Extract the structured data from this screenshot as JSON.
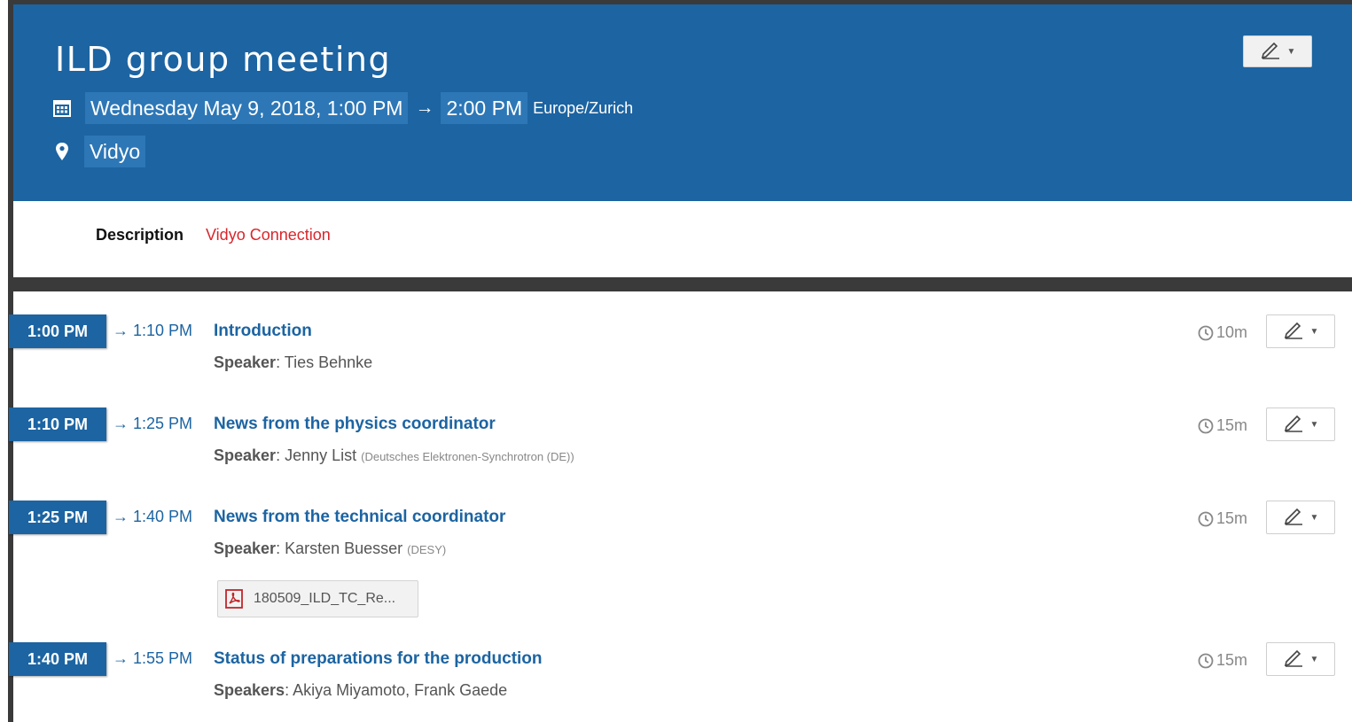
{
  "event": {
    "title": "ILD group meeting",
    "start_datetime": "Wednesday May 9, 2018, 1:00 PM",
    "arrow": "→",
    "end_time": "2:00 PM",
    "timezone": "Europe/Zurich",
    "location": "Vidyo",
    "description_label": "Description",
    "description_value": "Vidyo Connection"
  },
  "colors": {
    "header_bg": "#1c64a2",
    "chip_bg": "#2d77b6",
    "link": "#1c64a2",
    "description_link": "#d9262b"
  },
  "timetable": [
    {
      "start": "1:00 PM",
      "end": "→ 1:10 PM",
      "title": "Introduction",
      "speaker_label": "Speaker",
      "speakers": ": Ties Behnke",
      "affiliation": "",
      "duration": "10m"
    },
    {
      "start": "1:10 PM",
      "end": "→ 1:25 PM",
      "title": "News from the physics coordinator",
      "speaker_label": "Speaker",
      "speakers": ": Jenny List",
      "affiliation": "(Deutsches Elektronen-Synchrotron (DE))",
      "duration": "15m"
    },
    {
      "start": "1:25 PM",
      "end": "→ 1:40 PM",
      "title": "News from the technical coordinator",
      "speaker_label": "Speaker",
      "speakers": ": Karsten Buesser",
      "affiliation": "(DESY)",
      "duration": "15m",
      "attachment": "180509_ILD_TC_Re..."
    },
    {
      "start": "1:40 PM",
      "end": "→ 1:55 PM",
      "title": "Status of preparations for the production",
      "speaker_label": "Speakers",
      "speakers": ": Akiya Miyamoto, Frank Gaede",
      "affiliation": "",
      "duration": "15m"
    }
  ],
  "icons": {
    "calendar": "calendar-icon",
    "location": "map-pin-icon",
    "edit": "pencil-icon",
    "clock": "clock-icon",
    "pdf": "pdf-file-icon"
  }
}
